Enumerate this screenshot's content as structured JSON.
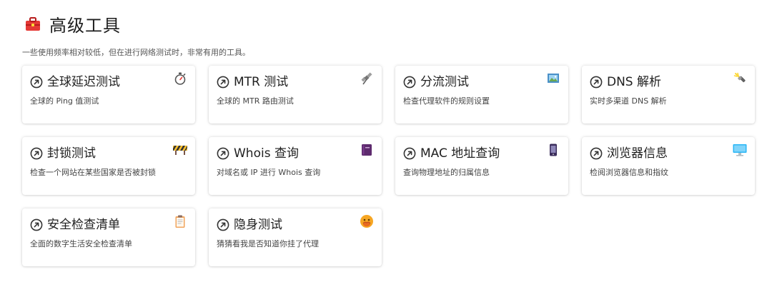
{
  "header": {
    "title": "高级工具",
    "icon": "toolbox-icon",
    "subtitle": "一些使用频率相对较低，但在进行网络测试时，非常有用的工具。"
  },
  "cards": [
    {
      "title": "全球延迟测试",
      "desc": "全球的 Ping 值测试",
      "icon": "stopwatch-icon"
    },
    {
      "title": "MTR 测试",
      "desc": "全球的 MTR 路由测试",
      "icon": "satellite-icon"
    },
    {
      "title": "分流测试",
      "desc": "检查代理软件的规则设置",
      "icon": "framed-picture-icon"
    },
    {
      "title": "DNS 解析",
      "desc": "实时多渠道 DNS 解析",
      "icon": "flashlight-icon"
    },
    {
      "title": "封锁测试",
      "desc": "检查一个网站在某些国家是否被封锁",
      "icon": "construction-barrier-icon"
    },
    {
      "title": "Whois 查询",
      "desc": "对域名或 IP 进行 Whois 查询",
      "icon": "book-icon"
    },
    {
      "title": "MAC 地址查询",
      "desc": "查询物理地址的归属信息",
      "icon": "mobile-phone-icon"
    },
    {
      "title": "浏览器信息",
      "desc": "检阅浏览器信息和指纹",
      "icon": "desktop-monitor-icon"
    },
    {
      "title": "安全检查清单",
      "desc": "全面的数字生活安全检查清单",
      "icon": "clipboard-icon"
    },
    {
      "title": "隐身测试",
      "desc": "猜猜看我是否知道你挂了代理",
      "icon": "hiding-face-icon"
    }
  ]
}
